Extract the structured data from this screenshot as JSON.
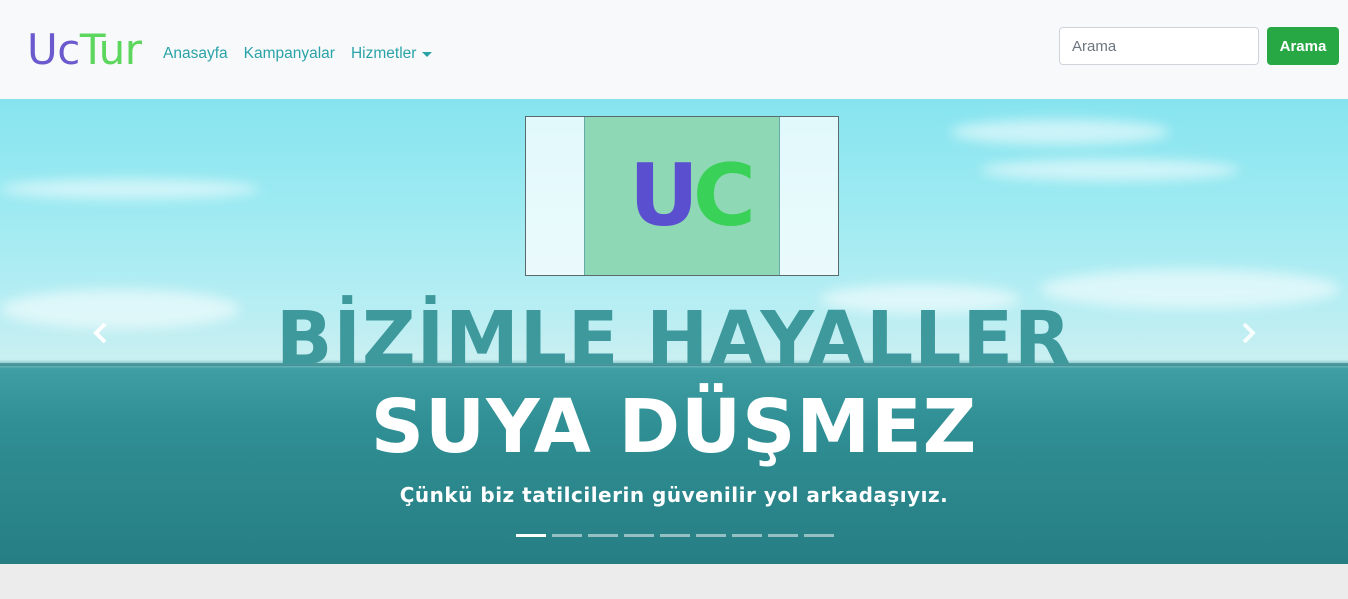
{
  "navbar": {
    "brand_uc": "Uc",
    "brand_tur": "Tur",
    "links": [
      {
        "label": "Anasayfa"
      },
      {
        "label": "Kampanyalar"
      },
      {
        "label": "Hizmetler"
      }
    ],
    "search": {
      "placeholder": "Arama",
      "button_label": "Arama"
    }
  },
  "carousel": {
    "logo_u": "U",
    "logo_c": "C",
    "headline_top": "BİZİMLE HAYALLER",
    "headline_bottom": "SUYA DÜŞMEZ",
    "subline": "Çünkü biz tatilcilerin güvenilir yol arkadaşıyız.",
    "prev_icon": "chevron-left-icon",
    "next_icon": "chevron-right-icon",
    "slide_count": 9,
    "active_slide": 1
  },
  "colors": {
    "brand_uc": "#6a5acd",
    "brand_tur": "#5cd65c",
    "link": "#2aa3a8",
    "search_button": "#28a745"
  }
}
